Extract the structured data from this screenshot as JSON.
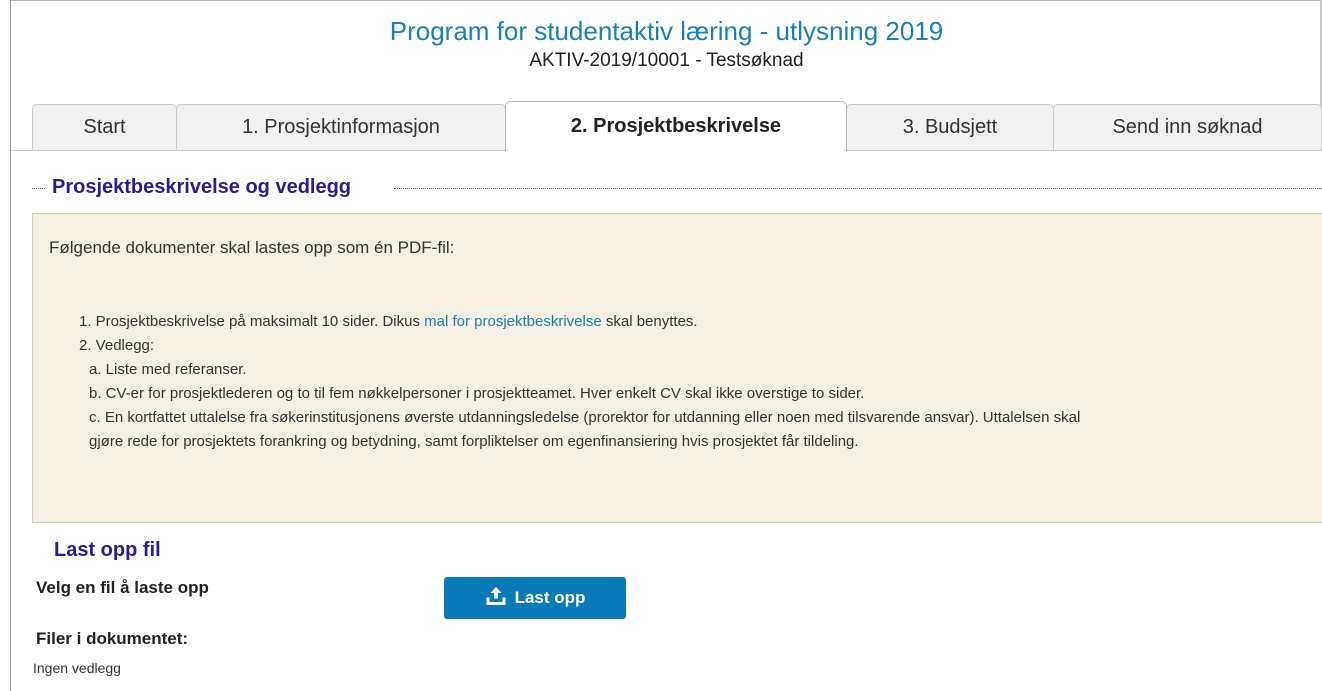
{
  "header": {
    "title": "Program for studentaktiv læring - utlysning 2019",
    "subtitle": "AKTIV-2019/10001 - Testsøknad"
  },
  "tabs": [
    {
      "label": "Start",
      "active": false
    },
    {
      "label": "1. Prosjektinformasjon",
      "active": false
    },
    {
      "label": "2. Prosjektbeskrivelse",
      "active": true
    },
    {
      "label": "3. Budsjett",
      "active": false
    },
    {
      "label": "Send inn søknad",
      "active": false
    }
  ],
  "section": {
    "title": "Prosjektbeskrivelse og vedlegg",
    "intro": "Følgende dokumenter skal lastes opp som én PDF-fil:",
    "items": {
      "item1_prefix": "1. Prosjektbeskrivelse på maksimalt 10 sider. Dikus ",
      "item1_link": "mal for prosjektbeskrivelse",
      "item1_suffix": " skal benyttes.",
      "item2": "2. Vedlegg:",
      "item2a": "a. Liste med referanser.",
      "item2b": "b. CV-er for prosjektlederen og to til fem nøkkelpersoner i prosjektteamet. Hver enkelt CV skal ikke overstige to sider.",
      "item2c_line1": "c. En kortfattet uttalelse fra søkerinstitusjonens øverste utdanningsledelse (prorektor for utdanning eller noen med tilsvarende ansvar). Uttalelsen skal",
      "item2c_line2": "gjøre rede for prosjektets forankring og betydning, samt forpliktelser om egenfinansiering hvis prosjektet får tildeling."
    }
  },
  "upload": {
    "title": "Last opp fil",
    "choose_label": "Velg en fil å laste opp",
    "button_label": "Last opp",
    "button_icon": "upload-icon",
    "button_color": "#0a7ab6",
    "files_label": "Filer i dokumentet:",
    "no_files": "Ingen vedlegg"
  },
  "colors": {
    "title": "#1a7fb5",
    "section_heading": "#2a1c8c",
    "info_background": "#f4f1e4"
  }
}
